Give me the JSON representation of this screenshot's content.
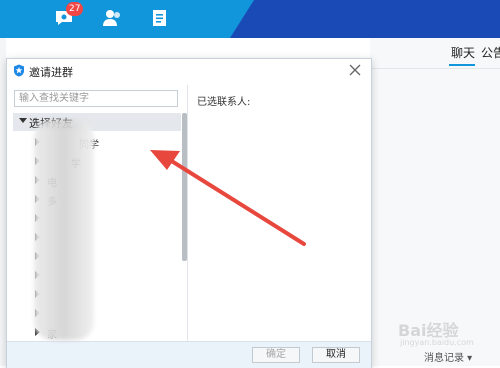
{
  "app": {
    "badge_count": "27",
    "colors": {
      "topbar": "#1296db",
      "topbar_dark": "#1a4ab5",
      "arrow": "#e8473d",
      "accent": "#1296db"
    },
    "top_icons": [
      "chat-icon",
      "contacts-icon",
      "document-icon"
    ]
  },
  "right_pane": {
    "tabs": [
      {
        "label": "聊天"
      },
      {
        "label": "公告"
      }
    ],
    "history_button": "消息记录 ▾"
  },
  "dialog": {
    "title": "邀请进群",
    "search_placeholder": "输入查找关键字",
    "tree_root": "选择好友",
    "tree_items": [
      {
        "label": "同学"
      },
      {
        "label": "学"
      },
      {
        "label": "电"
      },
      {
        "label": "多"
      },
      {
        "label": ""
      },
      {
        "label": ""
      },
      {
        "label": ""
      },
      {
        "label": ""
      },
      {
        "label": ""
      },
      {
        "label": ""
      },
      {
        "label": "家"
      }
    ],
    "selected_contacts_label": "已选联系人:",
    "ok_button": "确定",
    "cancel_button": "取消"
  },
  "watermark": {
    "text": "Bai经验",
    "sub": "jingyan.baidu.com"
  }
}
